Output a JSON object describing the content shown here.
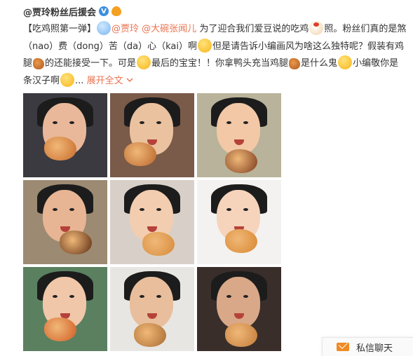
{
  "post": {
    "author": "@贾玲粉丝后援会",
    "badges": {
      "verified": "V",
      "balloon": ""
    },
    "text": {
      "p1": "【吃鸡照第一弹】",
      "m1": "@贾玲",
      "m2": "@大碗张闻儿",
      "p2": " 为了迎合我们爱豆说的吃鸡",
      "p3": "照。粉丝们真的是煞（nao）费（dong）苦（da）心（kai）啊",
      "p4": "但是请告诉小编画风为啥这么独特呢？假装有鸡腿",
      "p5": "的还能接受一下。可是",
      "p6": "最后的宝宝！！你拿鸭头充当鸡腿",
      "p7": "是什么鬼",
      "p8": "小编敬你是条汉子啊",
      "ellipsis": "...",
      "expand": "展开全文 ",
      "expand_icon": "chevron-down-icon"
    },
    "photos": [
      {
        "bg": "#3b3a40",
        "skin": "#e9b89a",
        "food": "#c86a2a"
      },
      {
        "bg": "#7a5a48",
        "skin": "#eac2a0",
        "food": "#b8652a"
      },
      {
        "bg": "#b8b39a",
        "skin": "#f2c8a6",
        "food": "#7a3a1c"
      },
      {
        "bg": "#9c8a72",
        "skin": "#e7b594",
        "food": "#5a2a12"
      },
      {
        "bg": "#d8d0c8",
        "skin": "#f3cdb0",
        "food": "#d68a3a"
      },
      {
        "bg": "#f4f2f0",
        "skin": "#f6d4bc",
        "food": "#d8862e"
      },
      {
        "bg": "#5a8060",
        "skin": "#f0c7a8",
        "food": "#d25a22"
      },
      {
        "bg": "#e8e6e2",
        "skin": "#e8be9c",
        "food": "#a86a30"
      },
      {
        "bg": "#3a2e2a",
        "skin": "#d9a888",
        "food": "#c27a38"
      }
    ]
  },
  "chat": {
    "label": "私信聊天",
    "icon": "mail-icon"
  },
  "colors": {
    "link": "#eb7350",
    "text": "#333333",
    "badge_blue": "#3b8fe0",
    "chat_icon": "#f08a24"
  }
}
